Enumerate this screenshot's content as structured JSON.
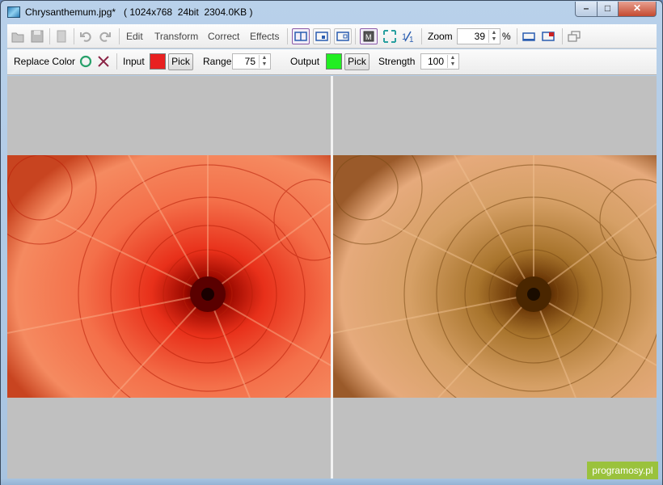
{
  "window": {
    "title": "Chrysanthemum.jpg*   ( 1024x768  24bit  2304.0KB )",
    "controls": {
      "minimize": "–",
      "maximize": "□",
      "close": "✕"
    }
  },
  "toolbar": {
    "menus": [
      "Edit",
      "Transform",
      "Correct",
      "Effects"
    ],
    "zoom_label": "Zoom",
    "zoom_value": "39",
    "zoom_unit": "%",
    "icons": [
      "open-icon",
      "save-icon",
      "page-icon",
      "undo-icon",
      "redo-icon",
      "view-split-icon",
      "view-single-icon",
      "view-fit-icon",
      "actual-size-icon",
      "fit-window-icon",
      "ratio-icon",
      "fullscreen-icon",
      "window-icon",
      "copy-windows-icon"
    ]
  },
  "replace_color": {
    "tool_label": "Replace Color",
    "input_label": "Input",
    "input_color": "#e82020",
    "pick_label": "Pick",
    "range_label": "Range",
    "range_value": "75",
    "output_label": "Output",
    "output_color": "#22ee22",
    "output_pick_label": "Pick",
    "strength_label": "Strength",
    "strength_value": "100"
  },
  "watermark": {
    "text": "programosy.pl"
  }
}
